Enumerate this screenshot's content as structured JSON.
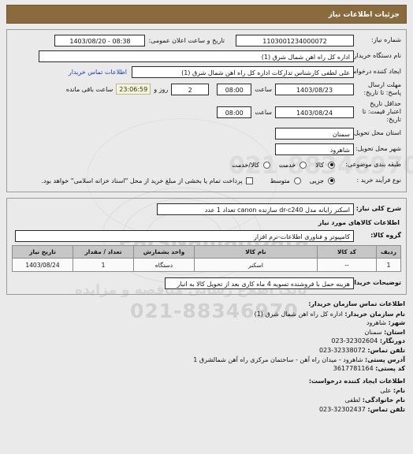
{
  "header": {
    "title": "جزئیات اطلاعات نیاز"
  },
  "top_form": {
    "need_number_label": "شماره نیاز:",
    "need_number_value": "1103001234000072",
    "announce_date_label": "تاریخ و ساعت اعلان عمومی:",
    "announce_date_value": "1403/08/20 - 08:38",
    "buyer_org_label": "نام دستگاه خریدار:",
    "buyer_org_value": "اداره کل راه اهن شمال شرق (1)",
    "requester_label": "ایجاد کننده درخواست:",
    "requester_value": "علی لطفی کارشناس تدارکات اداره کل راه اهن شمال شرق (1)",
    "buyer_contact_link": "اطلاعات تماس خریدار",
    "deadline_label": "مهلت ارسال پاسخ: تا تاریخ:",
    "deadline_date": "1403/08/23",
    "hour_label": "ساعت",
    "deadline_hour": "08:00",
    "days_value": "2",
    "days_label": "روز و",
    "countdown_value": "23:06:59",
    "remaining_label": "ساعت باقی مانده",
    "validity_label": "حداقل تاریخ اعتبار قیمت: تا تاریخ:",
    "validity_date": "1403/08/24",
    "validity_hour": "08:00",
    "province_label": "استان محل تحویل:",
    "province_value": "سمنان",
    "city_label": "شهر محل تحویل:",
    "city_value": "شاهرود",
    "category_label": "طبقه بندی موضوعی:",
    "category_options": [
      {
        "label": "کالا",
        "selected": true
      },
      {
        "label": "خدمت",
        "selected": false
      },
      {
        "label": "کالا/خدمت",
        "selected": false
      }
    ],
    "process_label": "نوع فرآیند خرید :",
    "process_options": [
      {
        "label": "جزیی",
        "selected": true
      },
      {
        "label": "متوسط",
        "selected": false
      }
    ],
    "treasury_checkbox_label": "پرداخت تمام یا بخشی از مبلغ خرید از محل \"اسناد خزانه اسلامی\" خواهد بود.",
    "treasury_checked": false
  },
  "need_summary": {
    "label": "شرح کلی نیاز:",
    "value": "اسکنر رایانه مدل dr-c240 سازنده canon تعداد 1 عدد"
  },
  "goods_section": {
    "heading": "اطلاعات کالاهای مورد نیاز",
    "group_label": "گروه کالا:",
    "group_value": "کامپیوتر و فناوری اطلاعات-نرم افزار",
    "columns": [
      "ردیف",
      "کد کالا",
      "نام کالا",
      "واحد بشمارش",
      "تعداد / مقدار",
      "تاریخ نیاز"
    ],
    "rows": [
      {
        "index": "1",
        "code": "--",
        "name": "اسکنر",
        "unit": "دستگاه",
        "qty": "1",
        "need_date": "1403/08/24"
      }
    ],
    "buyer_notes_label": "توضیحات خریدار:",
    "buyer_notes_value": "هزینه حمل با فروشنده تسویه 4 ماه کاری بعد از تحویل کالا به انبار"
  },
  "buyer_contact": {
    "heading": "اطلاعات تماس سازمان خریدار:",
    "org_label": "نام سازمان خریدار:",
    "org_value": "اداره کل راه اهن شمال شرق (1)",
    "city_label": "شهر:",
    "city_value": "شاهرود",
    "province_label": "استان:",
    "province_value": "سمنان",
    "fax_label": "دورنگار:",
    "fax_value": "023-32302604",
    "phone_label": "تلفن تماس:",
    "phone_value": "023-32338072",
    "address_label": "آدرس پستی:",
    "address_value": "شاهرود - میدان راه آهن - ساختمان مرکزی راه آهن شمالشرق 1",
    "postal_label": "کد پستی:",
    "postal_value": "3617781164"
  },
  "requester_contact": {
    "heading": "اطلاعات ایجاد کننده درخواست:",
    "first_name_label": "نام:",
    "first_name_value": "علی",
    "last_name_label": "نام خانوادگی:",
    "last_name_value": "لطفی",
    "phone_label": "تلفن تماس:",
    "phone_value": "023-32302437"
  },
  "watermark": {
    "line1": "ParsNamadData",
    "line2": "مرکز اطلاعات پارس",
    "line3": "بانک اطلاع رسانی مناقصه و مزایده",
    "line4": "021-88346970"
  },
  "colors": {
    "header_bg": "#8a6b3d",
    "header_text": "#ffffff",
    "link": "#1b3fbf",
    "countdown_bg": "#f5f5d8",
    "table_header_bg": "#c6c6c6"
  }
}
